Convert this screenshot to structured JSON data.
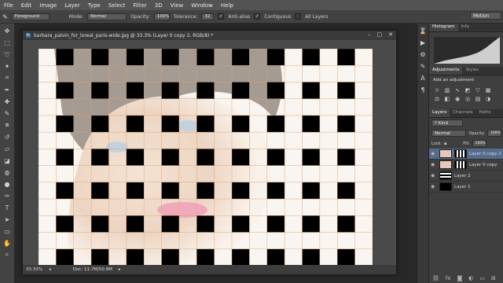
{
  "menu": [
    "File",
    "Edit",
    "Image",
    "Layer",
    "Type",
    "Select",
    "Filter",
    "3D",
    "View",
    "Window",
    "Help"
  ],
  "options": {
    "sample_value": "Foreground",
    "mode_label": "Mode:",
    "mode_value": "Normal",
    "opacity_label": "Opacity:",
    "opacity_value": "100%",
    "tolerance_label": "Tolerance:",
    "tolerance_value": "32",
    "antialias_label": "Anti-alias",
    "contiguous_label": "Contiguous",
    "all_layers_label": "All Layers",
    "workspace": "Motion"
  },
  "document": {
    "title": "barbara_palvin_for_loreal_paris-wide.jpg @ 33.3% (Layer 0 copy 2, RGB/8) *",
    "zoom": "33.33%",
    "doc_info": "Doc: 11.7M/50.8M"
  },
  "pattern": {
    "rows": 13,
    "cols": 19,
    "black": "#000000",
    "light": "#fdf7f0",
    "grid_color": "#d8a068"
  },
  "panels": {
    "top_tabs": [
      "Histogram",
      "Info"
    ],
    "adjust_tabs": [
      "Adjustments",
      "Styles"
    ],
    "add_adjustment": "Add an adjustment",
    "layers_tabs": [
      "Layers",
      "Channels",
      "Paths"
    ],
    "kind_label": "Kind",
    "blend_value": "Normal",
    "opacity_label": "Opacity:",
    "opacity_value": "100%",
    "lock_label": "Lock:",
    "fill_label": "Fill:",
    "fill_value": "100%",
    "layers": [
      "Layer 0 copy 2",
      "Layer 0 copy",
      "Layer 2",
      "Layer 1"
    ]
  }
}
